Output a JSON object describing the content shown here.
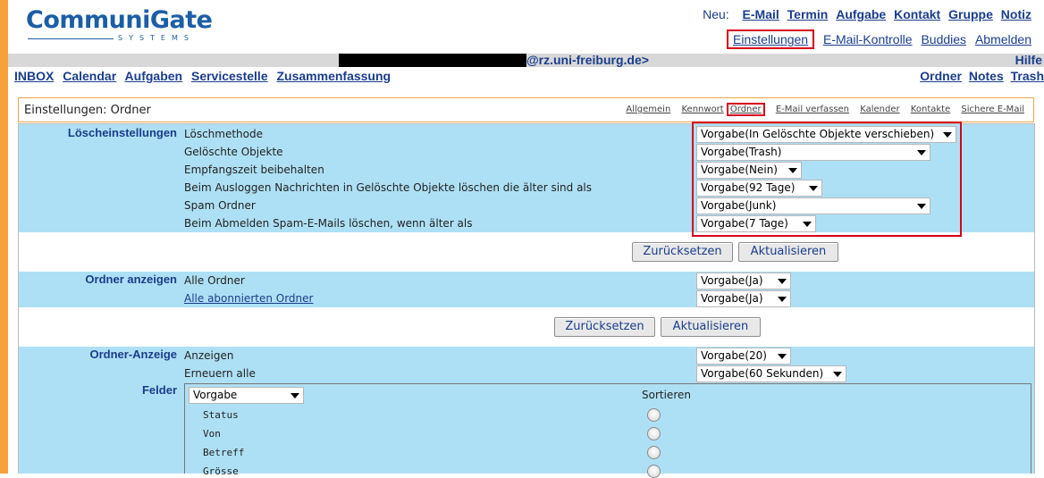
{
  "brand": {
    "name": "CommuniGate",
    "tagline": "SYSTEMS"
  },
  "new_menu": {
    "label": "Neu:",
    "items": [
      "E-Mail",
      "Termin",
      "Aufgabe",
      "Kontakt",
      "Gruppe",
      "Notiz"
    ]
  },
  "util_menu": {
    "items": [
      "Einstellungen",
      "E-Mail-Kontrolle",
      "Buddies",
      "Abmelden"
    ],
    "highlighted": "Einstellungen"
  },
  "account": {
    "address_suffix": "@rz.uni-freiburg.de>",
    "help": "Hilfe"
  },
  "nav": {
    "left": [
      "INBOX",
      "Calendar",
      "Aufgaben",
      "Servicestelle",
      "Zusammenfassung"
    ],
    "right": [
      "Ordner",
      "Notes",
      "Trash"
    ]
  },
  "settings": {
    "title": "Einstellungen: Ordner",
    "tabs": [
      "Allgemein",
      "Kennwort",
      "Ordner",
      "E-Mail verfassen",
      "Kalender",
      "Kontakte",
      "Sichere E-Mail"
    ],
    "active_tab": "Ordner"
  },
  "sections": {
    "loesch": {
      "label": "Löscheinstellungen",
      "rows": [
        {
          "label": "Löschmethode",
          "value": "Vorgabe(In Gelöschte Objekte verschieben)"
        },
        {
          "label": "Gelöschte Objekte",
          "value": "Vorgabe(Trash)"
        },
        {
          "label": "Empfangszeit beibehalten",
          "value": "Vorgabe(Nein)"
        },
        {
          "label": "Beim Ausloggen Nachrichten in Gelöschte Objekte löschen die älter sind als",
          "value": "Vorgabe(92 Tage)"
        },
        {
          "label": "Spam Ordner",
          "value": "Vorgabe(Junk)"
        },
        {
          "label": "Beim Abmelden Spam-E-Mails löschen, wenn älter als",
          "value": "Vorgabe(7 Tage)"
        }
      ]
    },
    "anzeigen": {
      "label": "Ordner anzeigen",
      "rows": [
        {
          "label": "Alle Ordner",
          "value": "Vorgabe(Ja)"
        },
        {
          "label": "Alle abonnierten Ordner",
          "value": "Vorgabe(Ja)"
        }
      ]
    },
    "ordner_anzeige": {
      "label": "Ordner-Anzeige",
      "rows": [
        {
          "label": "Anzeigen",
          "value": "Vorgabe(20)"
        },
        {
          "label": "Erneuern alle",
          "value": "Vorgabe(60 Sekunden)"
        }
      ]
    },
    "felder": {
      "label": "Felder",
      "select_value": "Vorgabe",
      "sort_label": "Sortieren",
      "fields": [
        "Status",
        "Von",
        "Betreff",
        "Grösse"
      ]
    }
  },
  "buttons": {
    "reset": "Zurücksetzen",
    "update": "Aktualisieren"
  },
  "colors": {
    "accent_orange": "#f6a13a",
    "row_blue": "#aee0f5",
    "link_blue": "#1a3d8c",
    "highlight_red": "#d8001a"
  }
}
